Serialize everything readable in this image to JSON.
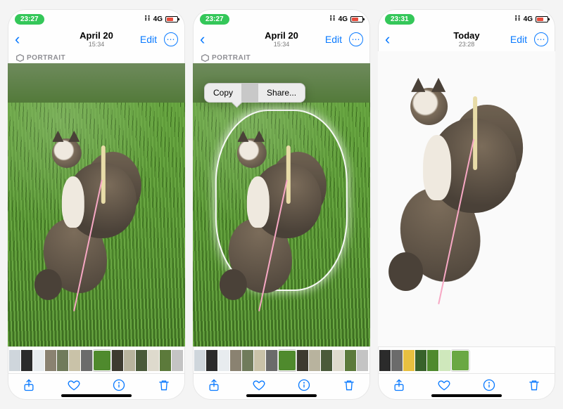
{
  "network_label": "4G",
  "edit_label": "Edit",
  "portrait_label": "PORTRAIT",
  "context_menu": {
    "copy": "Copy",
    "share": "Share..."
  },
  "screens": [
    {
      "time": "23:27",
      "date": "April 20",
      "subtime": "15:34",
      "show_portrait": true,
      "show_menu": false,
      "bg": "grass",
      "strip": "library"
    },
    {
      "time": "23:27",
      "date": "April 20",
      "subtime": "15:34",
      "show_portrait": true,
      "show_menu": true,
      "bg": "grass",
      "strip": "library"
    },
    {
      "time": "23:31",
      "date": "Today",
      "subtime": "23:28",
      "show_portrait": false,
      "show_menu": false,
      "bg": "white",
      "strip": "short"
    }
  ],
  "strip_colors_library": [
    "#cfd6dc",
    "#2b2b2b",
    "#e8ecef",
    "#8a8271",
    "#707b5b",
    "#c9c2a8",
    "#6b6b6b",
    "#4f8a2d",
    "#3d3a30",
    "#b8b39e",
    "#4a5a3a",
    "#dedacd",
    "#5c7a3b",
    "#c4c4c4"
  ],
  "strip_colors_short": [
    "#2b2b2b",
    "#6b6b6b",
    "#e8c040",
    "#38622b",
    "#4f8a2d",
    "#cfe8bc",
    "#6aa843"
  ]
}
